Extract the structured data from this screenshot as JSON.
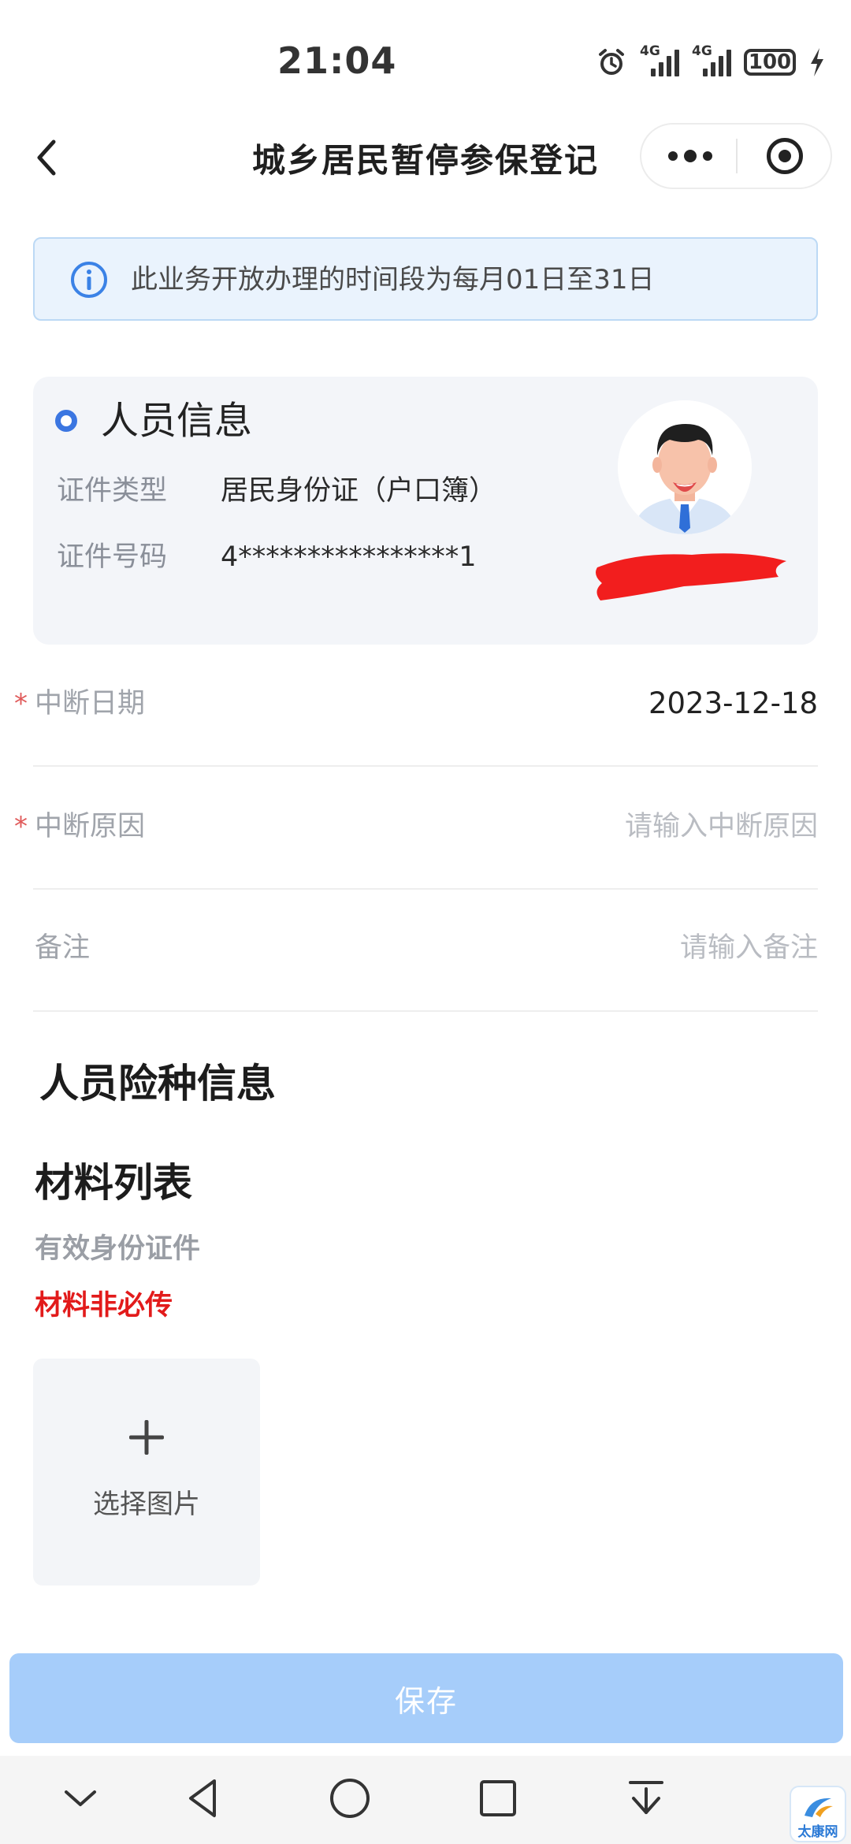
{
  "status_bar": {
    "time": "21:04",
    "signal_1_label": "4G",
    "signal_2_label": "4G",
    "battery": "100"
  },
  "nav": {
    "title": "城乡居民暂停参保登记"
  },
  "notice": {
    "text": "此业务开放办理的时间段为每月01日至31日"
  },
  "person_card": {
    "title": "人员信息",
    "id_type_label": "证件类型",
    "id_type_value": "居民身份证（户口簿）",
    "id_number_label": "证件号码",
    "id_number_value": "4****************1"
  },
  "form": {
    "interrupt_date": {
      "required_mark": "*",
      "label": "中断日期",
      "value": "2023-12-18"
    },
    "interrupt_reason": {
      "required_mark": "*",
      "label": "中断原因",
      "placeholder": "请输入中断原因"
    },
    "remark": {
      "label": "备注",
      "placeholder": "请输入备注"
    }
  },
  "insurance_section": {
    "title": "人员险种信息"
  },
  "materials": {
    "title": "材料列表",
    "item_label": "有效身份证件",
    "optional_note": "材料非必传",
    "upload_label": "选择图片"
  },
  "actions": {
    "save_label": "保存"
  },
  "watermark": {
    "text": "太康网"
  },
  "colors": {
    "accent": "#3b76e1",
    "notice_bg": "#eaf3fd",
    "required_red": "#e21b1b",
    "save_button": "#a6cdfa"
  }
}
